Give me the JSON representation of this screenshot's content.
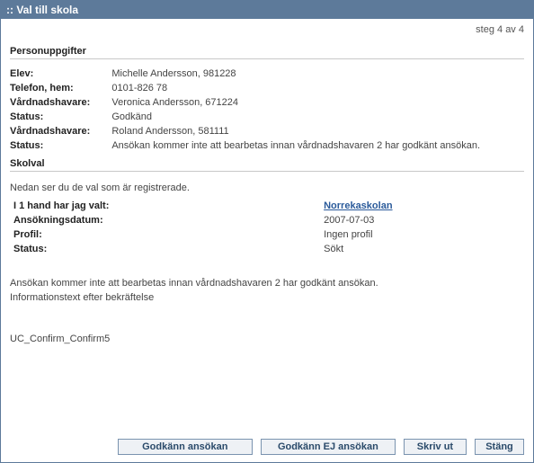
{
  "titlebar": ":: Val till skola",
  "step": "steg 4 av 4",
  "section1": {
    "header": "Personuppgifter",
    "rows": {
      "elev_label": "Elev:",
      "elev_value": "Michelle Andersson, 981228",
      "tel_label": "Telefon, hem:",
      "tel_value": "0101-826 78",
      "v1_label": "Vårdnadshavare:",
      "v1_value": "Veronica Andersson, 671224",
      "s1_label": "Status:",
      "s1_value": "Godkänd",
      "v2_label": "Vårdnadshavare:",
      "v2_value": "Roland Andersson, 581111",
      "s2_label": "Status:",
      "s2_value": "Ansökan kommer inte att bearbetas innan vårdnadshavaren 2 har godkänt ansökan."
    }
  },
  "section2": {
    "header": "Skolval",
    "intro": "Nedan ser du de val som är registrerade.",
    "rows": {
      "choice_label": "I 1 hand har jag valt:",
      "choice_value": "Norrekaskolan",
      "date_label": "Ansökningsdatum:",
      "date_value": "2007-07-03",
      "profile_label": "Profil:",
      "profile_value": "Ingen profil",
      "status_label": "Status:",
      "status_value": "Sökt"
    }
  },
  "notes": {
    "line1": "Ansökan kommer inte att bearbetas innan vårdnadshavaren 2 har godkänt ansökan.",
    "line2": "Informationstext efter bekräftelse"
  },
  "code": "UC_Confirm_Confirm5",
  "buttons": {
    "approve": "Godkänn ansökan",
    "reject": "Godkänn EJ ansökan",
    "print": "Skriv ut",
    "close": "Stäng"
  }
}
